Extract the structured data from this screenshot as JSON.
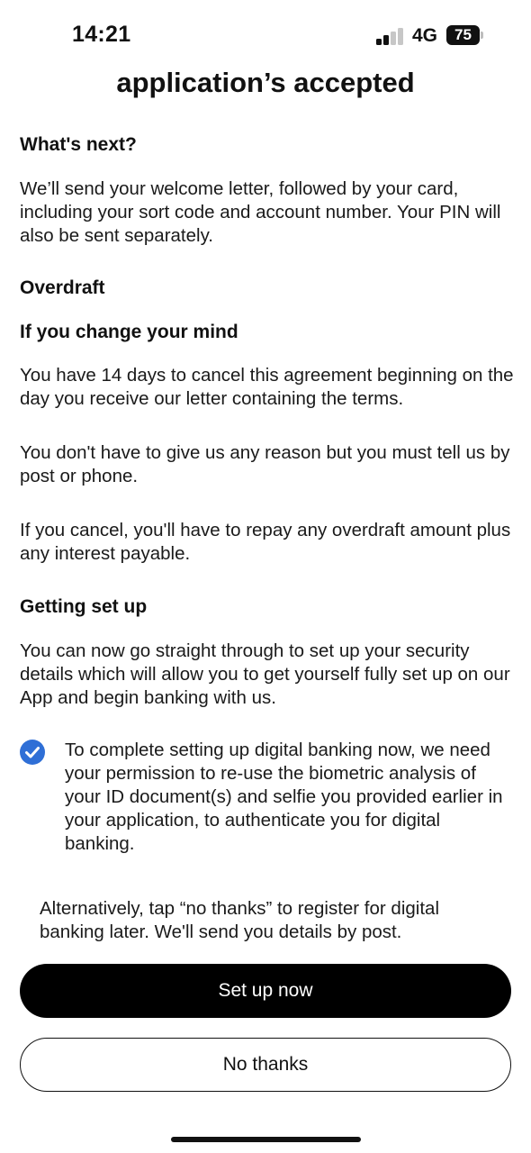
{
  "status_bar": {
    "time": "14:21",
    "network": "4G",
    "battery": "75"
  },
  "page": {
    "title": "application’s accepted"
  },
  "sections": {
    "whats_next": {
      "heading": "What's next?",
      "body": "We’ll send your welcome letter, followed by your card, including your sort code and account number. Your PIN will also be sent separately."
    },
    "overdraft": {
      "heading": "Overdraft"
    },
    "change_mind": {
      "heading": "If you change your mind",
      "para1": "You have 14 days to cancel this agreement beginning on the day you receive our letter containing the terms.",
      "para2": "You don't have to give us any reason but you must tell us by post or phone.",
      "para3": "If you cancel, you'll have to repay any overdraft amount plus any interest payable."
    },
    "getting_set_up": {
      "heading": "Getting set up",
      "body": "You can now go straight through to set up your security details which will allow you to get yourself fully set up on our App and begin banking with us."
    }
  },
  "consent": {
    "checked": true,
    "text": "To complete setting up digital banking now, we need your permission to re-use the biometric analysis of your ID document(s) and selfie you provided earlier in your application, to authenticate you for digital banking."
  },
  "alternative": {
    "text": "Alternatively, tap “no thanks” to register for digital banking later. We'll send you details by post."
  },
  "buttons": {
    "primary": "Set up now",
    "secondary": "No thanks"
  },
  "colors": {
    "accent_blue": "#2f6fd6",
    "primary_button": "#000000"
  },
  "icons": {
    "consent": "checkmark-circle-icon",
    "signal": "cellular-signal-icon",
    "battery": "battery-icon"
  }
}
